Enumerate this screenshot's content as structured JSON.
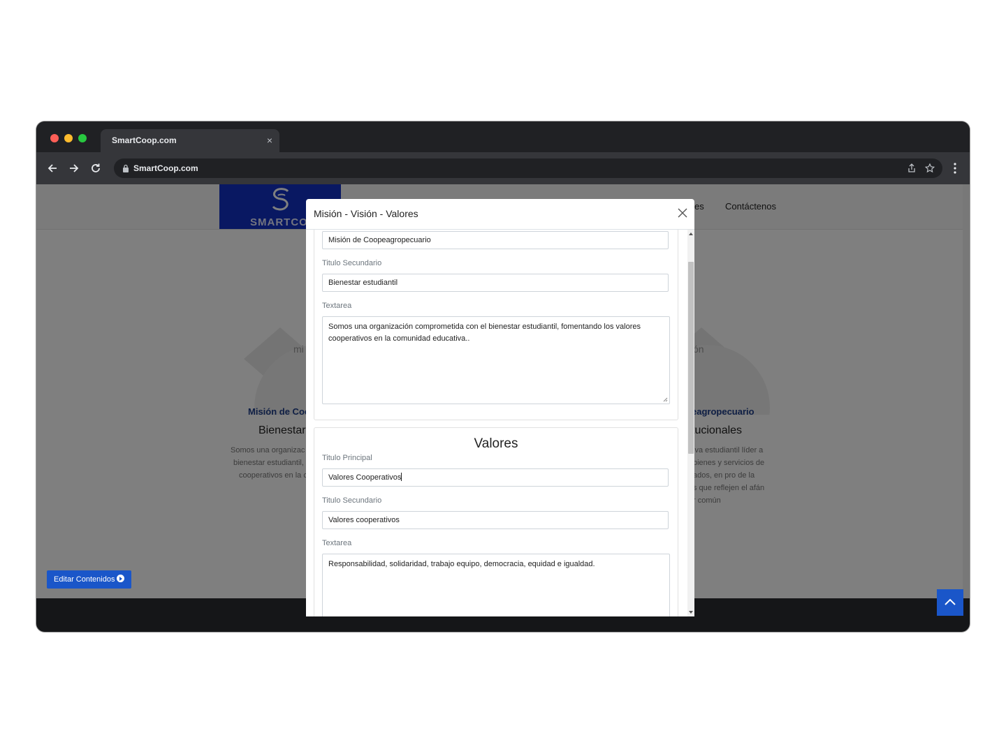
{
  "browser": {
    "tab_title": "SmartCoop.com",
    "url": "SmartCoop.com"
  },
  "site": {
    "logo_text": "SMARTCOOP",
    "nav": [
      "es",
      "Contáctenos"
    ],
    "cards": [
      {
        "emblem_word": "mi",
        "subtitle": "Misión de Coo",
        "title": "Bienestar",
        "lines": [
          "Somos una organizac",
          "bienestar estudiantil,",
          "cooperativos en la c"
        ]
      },
      {
        "emblem_word": "ón",
        "subtitle": "eagropecuario",
        "title": "tucionales",
        "lines": [
          "iva estudiantil líder a",
          "bienes y servicios de",
          "ados, en pro de la",
          "s que reflejen el afán",
          "r común"
        ]
      }
    ],
    "edit_button": "Editar Contenidos",
    "colors": {
      "accent": "#1a56c9",
      "logo_bg": "#1230c4",
      "footer": "#2a2c31"
    }
  },
  "modal": {
    "title": "Misión - Visión - Valores",
    "mision": {
      "titulo_principal_value": "Misión de Coopeagropecuario",
      "titulo_secundario_label": "Titulo Secundario",
      "titulo_secundario_value": "Bienestar estudiantil",
      "textarea_label": "Textarea",
      "textarea_value": "Somos una organización comprometida con el bienestar estudiantil, fomentando los valores cooperativos en la comunidad educativa.."
    },
    "valores": {
      "heading": "Valores",
      "titulo_principal_label": "Titulo Principal",
      "titulo_principal_value": "Valores Cooperativos",
      "titulo_secundario_label": "Titulo Secundario",
      "titulo_secundario_value": "Valores cooperativos",
      "textarea_label": "Textarea",
      "textarea_value": "Responsabilidad, solidaridad, trabajo equipo, democracia, equidad e igualdad."
    }
  }
}
